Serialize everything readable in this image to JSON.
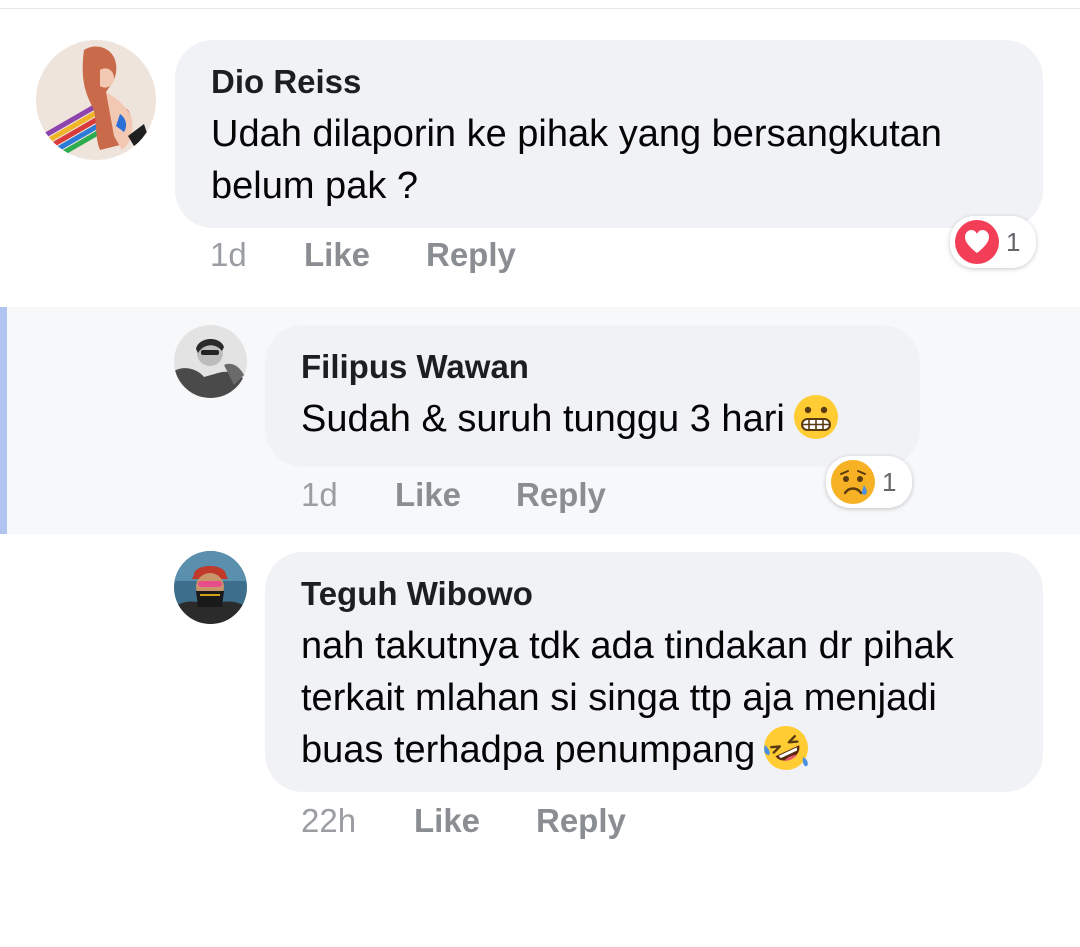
{
  "comments": [
    {
      "author": "Dio Reiss",
      "text": "Udah dilaporin ke pihak yang bersangkutan belum pak ?",
      "time": "1d",
      "like_label": "Like",
      "reply_label": "Reply",
      "reaction": {
        "icon": "heart-reaction-icon",
        "count": "1",
        "color": "#f33e58"
      }
    },
    {
      "author": "Filipus Wawan",
      "text": "Sudah & suruh tunggu 3 hari",
      "trailing_emoji": "grimacing-emoji-icon",
      "time": "1d",
      "like_label": "Like",
      "reply_label": "Reply",
      "highlighted": true,
      "reaction": {
        "icon": "sad-reaction-icon",
        "count": "1",
        "color": "#f7b125"
      }
    },
    {
      "author": "Teguh Wibowo",
      "text": "nah takutnya tdk ada tindakan dr pihak terkait mlahan si singa ttp aja menjadi buas terhadpa penumpang",
      "trailing_emoji": "rolling-on-floor-laughing-emoji-icon",
      "time": "22h",
      "like_label": "Like",
      "reply_label": "Reply"
    }
  ],
  "colors": {
    "bubble": "#f0f2f5",
    "highlight_bar": "#b0c4f0",
    "action_text": "#8a8d91"
  }
}
